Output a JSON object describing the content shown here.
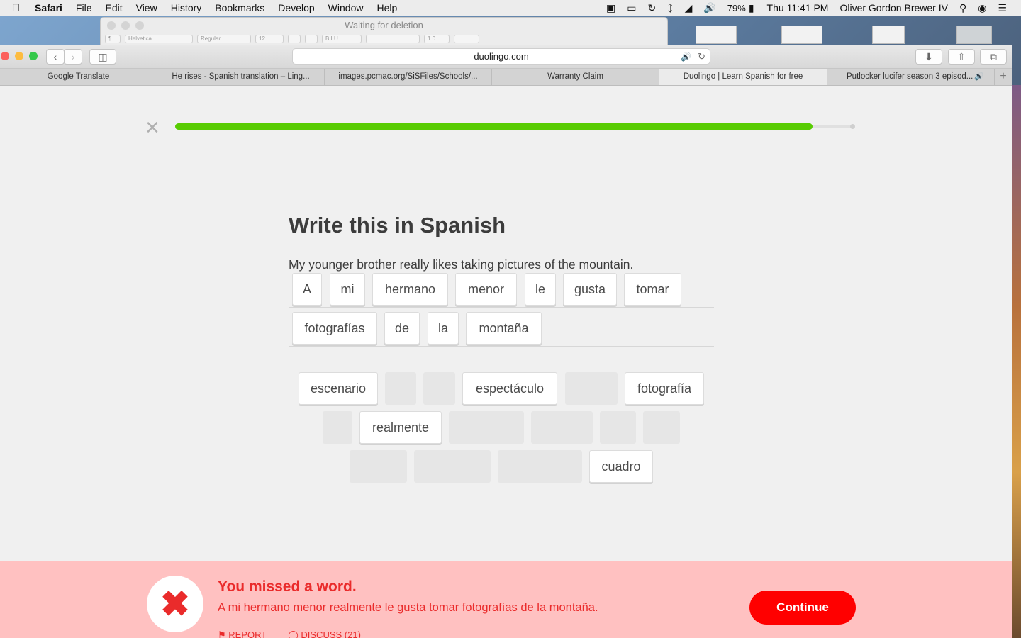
{
  "menubar": {
    "app_name": "Safari",
    "items": [
      "File",
      "Edit",
      "View",
      "History",
      "Bookmarks",
      "Develop",
      "Window",
      "Help"
    ],
    "battery": "79%",
    "clock": "Thu 11:41 PM",
    "user": "Oliver Gordon Brewer IV"
  },
  "bg_window": {
    "title": "Waiting for deletion",
    "font_name": "Helvetica",
    "font_style": "Regular",
    "font_size": "12",
    "spacing": "1.0"
  },
  "safari": {
    "url": "duolingo.com",
    "tabs": [
      {
        "label": "Google Translate"
      },
      {
        "label": "He rises - Spanish translation – Ling..."
      },
      {
        "label": "images.pcmac.org/SiSFiles/Schools/..."
      },
      {
        "label": "Warranty Claim"
      },
      {
        "label": "Duolingo | Learn Spanish for free"
      },
      {
        "label": "Putlocker lucifer season 3 episod..."
      }
    ],
    "active_tab_index": 4
  },
  "lesson": {
    "progress_percent": 94,
    "title": "Write this in Spanish",
    "sentence": "My younger brother really likes taking pictures of the mountain.",
    "answer_words": [
      "A",
      "mi",
      "hermano",
      "menor",
      "le",
      "gusta",
      "tomar",
      "fotografías",
      "de",
      "la",
      "montaña"
    ],
    "bank_words": [
      "escenario",
      "espectáculo",
      "fotografía",
      "realmente",
      "cuadro"
    ]
  },
  "feedback": {
    "title": "You missed a word.",
    "correct_answer": "A mi hermano menor realmente le gusta tomar fotografías de la montaña.",
    "report_label": "REPORT",
    "discuss_label": "DISCUSS (21)",
    "continue_label": "Continue"
  },
  "colors": {
    "progress_green": "#58cc02",
    "error_red": "#ea2b2b",
    "feedback_bg": "#ffc1c1",
    "continue_bg": "#ff0000"
  }
}
